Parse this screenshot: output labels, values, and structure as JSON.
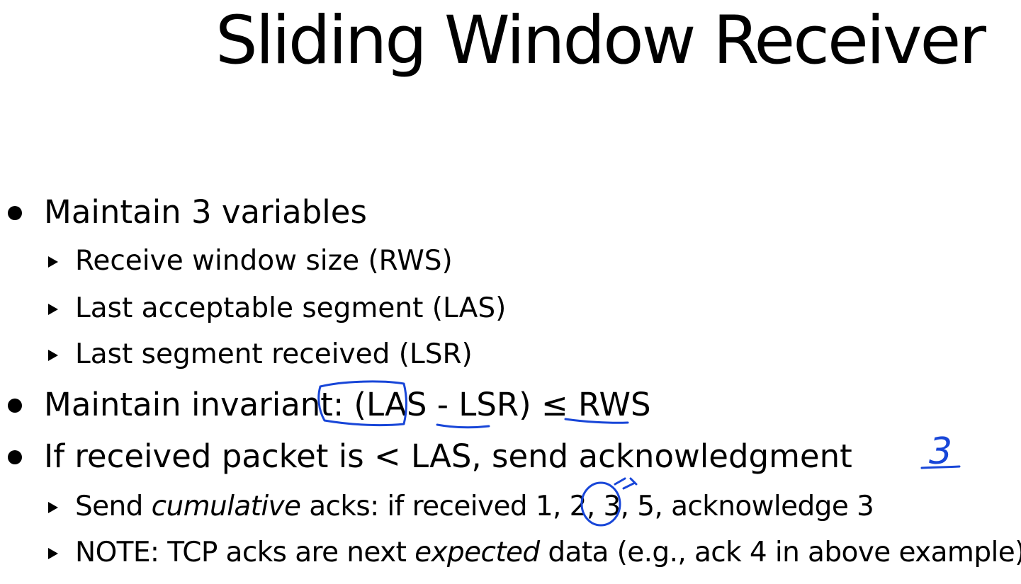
{
  "title": "Sliding Window Receiver",
  "bullets": {
    "b1": {
      "text": "Maintain 3 variables",
      "subs": [
        "Receive window size (RWS)",
        "Last acceptable segment (LAS)",
        "Last segment received (LSR)"
      ]
    },
    "b2": {
      "text": "Maintain invariant: (LAS - LSR) ≤ RWS"
    },
    "b3": {
      "text": "If received packet is < LAS,  send acknowledgment",
      "sub1": {
        "pre": "Send ",
        "em": "cumulative",
        "post": " acks: if received 1, 2, 3, 5, acknowledge 3"
      },
      "sub2": {
        "pre": "NOTE: TCP acks are next ",
        "em": "expected",
        "post": " data (e.g., ack 4 in above example)"
      }
    }
  },
  "annotations": {
    "handwritten_digit": "3",
    "ink_color": "#1846d8"
  }
}
